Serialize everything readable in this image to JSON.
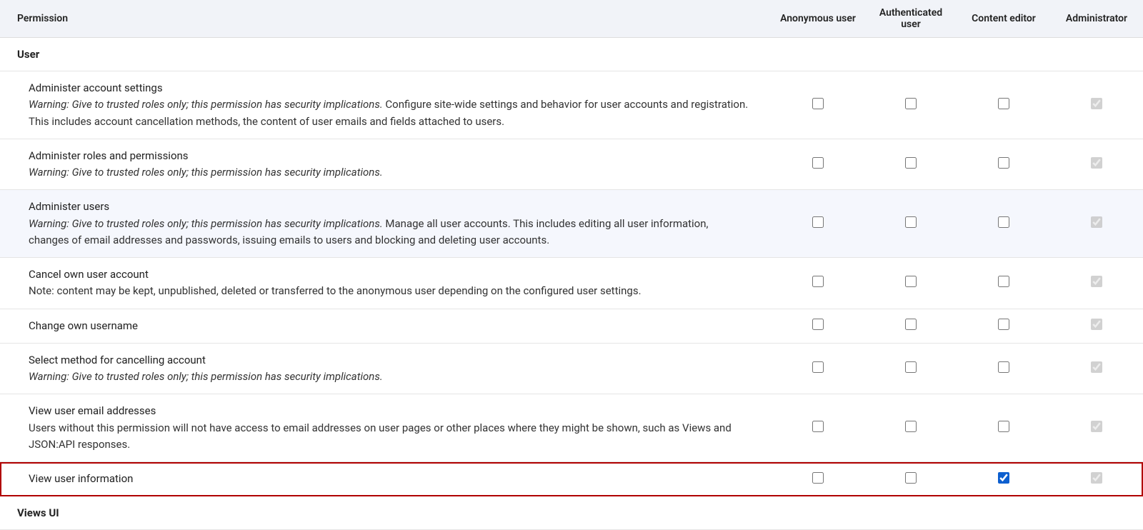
{
  "header": {
    "permission": "Permission",
    "roles": [
      "Anonymous user",
      "Authenticated user",
      "Content editor",
      "Administrator"
    ]
  },
  "sections": {
    "user": "User",
    "views_ui": "Views UI"
  },
  "permissions": [
    {
      "title": "Administer account settings",
      "warning": "Warning: Give to trusted roles only; this permission has security implications.",
      "description": "Configure site-wide settings and behavior for user accounts and registration. This includes account cancellation methods, the content of user emails and fields attached to users.",
      "checks": [
        {
          "checked": false,
          "disabled": false
        },
        {
          "checked": false,
          "disabled": false
        },
        {
          "checked": false,
          "disabled": false
        },
        {
          "checked": true,
          "disabled": true
        }
      ],
      "highlighted": false,
      "outlined": false
    },
    {
      "title": "Administer roles and permissions",
      "warning": "Warning: Give to trusted roles only; this permission has security implications.",
      "description": "",
      "checks": [
        {
          "checked": false,
          "disabled": false
        },
        {
          "checked": false,
          "disabled": false
        },
        {
          "checked": false,
          "disabled": false
        },
        {
          "checked": true,
          "disabled": true
        }
      ],
      "highlighted": false,
      "outlined": false
    },
    {
      "title": "Administer users",
      "warning": "Warning: Give to trusted roles only; this permission has security implications.",
      "description": "Manage all user accounts. This includes editing all user information, changes of email addresses and passwords, issuing emails to users and blocking and deleting user accounts.",
      "checks": [
        {
          "checked": false,
          "disabled": false
        },
        {
          "checked": false,
          "disabled": false
        },
        {
          "checked": false,
          "disabled": false
        },
        {
          "checked": true,
          "disabled": true
        }
      ],
      "highlighted": true,
      "outlined": false
    },
    {
      "title": "Cancel own user account",
      "warning": "",
      "description": "Note: content may be kept, unpublished, deleted or transferred to the anonymous user depending on the configured user settings.",
      "checks": [
        {
          "checked": false,
          "disabled": false
        },
        {
          "checked": false,
          "disabled": false
        },
        {
          "checked": false,
          "disabled": false
        },
        {
          "checked": true,
          "disabled": true
        }
      ],
      "highlighted": false,
      "outlined": false
    },
    {
      "title": "Change own username",
      "warning": "",
      "description": "",
      "checks": [
        {
          "checked": false,
          "disabled": false
        },
        {
          "checked": false,
          "disabled": false
        },
        {
          "checked": false,
          "disabled": false
        },
        {
          "checked": true,
          "disabled": true
        }
      ],
      "highlighted": false,
      "outlined": false
    },
    {
      "title": "Select method for cancelling account",
      "warning": "Warning: Give to trusted roles only; this permission has security implications.",
      "description": "",
      "checks": [
        {
          "checked": false,
          "disabled": false
        },
        {
          "checked": false,
          "disabled": false
        },
        {
          "checked": false,
          "disabled": false
        },
        {
          "checked": true,
          "disabled": true
        }
      ],
      "highlighted": false,
      "outlined": false
    },
    {
      "title": "View user email addresses",
      "warning": "",
      "description": "Users without this permission will not have access to email addresses on user pages or other places where they might be shown, such as Views and JSON:API responses.",
      "checks": [
        {
          "checked": false,
          "disabled": false
        },
        {
          "checked": false,
          "disabled": false
        },
        {
          "checked": false,
          "disabled": false
        },
        {
          "checked": true,
          "disabled": true
        }
      ],
      "highlighted": false,
      "outlined": false
    },
    {
      "title": "View user information",
      "warning": "",
      "description": "",
      "checks": [
        {
          "checked": false,
          "disabled": false
        },
        {
          "checked": false,
          "disabled": false
        },
        {
          "checked": true,
          "disabled": false
        },
        {
          "checked": true,
          "disabled": true
        }
      ],
      "highlighted": false,
      "outlined": true
    }
  ]
}
